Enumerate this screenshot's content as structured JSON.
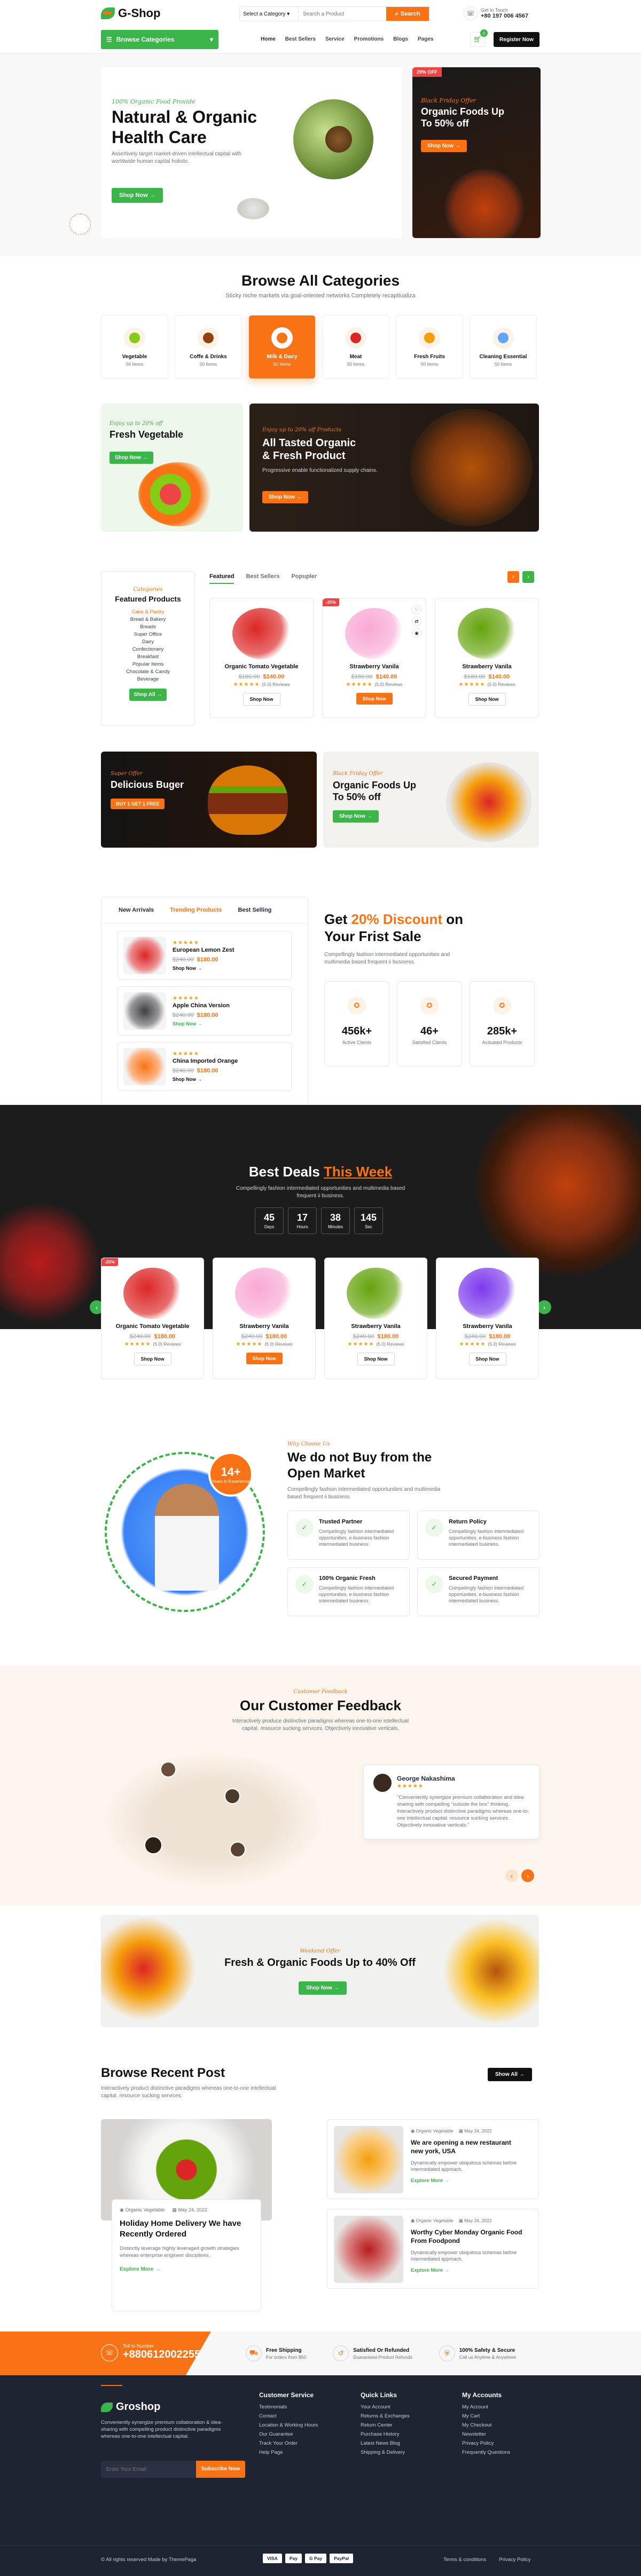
{
  "topbar": {
    "logo": "G-Shop",
    "categories_btn": "Browse Categories",
    "nav": [
      "Home",
      "Best Sellers",
      "Service",
      "Promotions",
      "Blogs",
      "Pages"
    ],
    "search_category": "Select a Category",
    "search_placeholder": "Search a Product",
    "search_btn": "Search",
    "contact_label": "Get In Touch",
    "contact_phone": "+80 197 006 4567",
    "cart_count": "0",
    "register": "Register Now"
  },
  "hero": {
    "tag": "100% Organic Food Provide",
    "title1": "Natural & Organic",
    "title2": "Health Care",
    "desc": "Assertively target market-driven intellectual capital with worldwide human capital holistic.",
    "btn": "Shop Now",
    "side_badge": "20% OFF",
    "side_tag": "Black Friday Offer",
    "side_title1": "Organic Foods Up",
    "side_title2": "To 50% off",
    "side_btn": "Shop Now"
  },
  "categories": {
    "title": "Browse All Categories",
    "sub": "Sticky niche markets via goal-oriented networks Completely recaptiualiza",
    "items": [
      {
        "name": "Vegetable",
        "count": "50 Items",
        "icon": "vegetable-icon"
      },
      {
        "name": "Coffe & Drinks",
        "count": "50 Items",
        "icon": "coffee-icon"
      },
      {
        "name": "Milk & Dairy",
        "count": "50 Items",
        "icon": "milk-icon"
      },
      {
        "name": "Meat",
        "count": "50 Items",
        "icon": "meat-icon"
      },
      {
        "name": "Fresh Fruits",
        "count": "50 Items",
        "icon": "fruit-icon"
      },
      {
        "name": "Cleaning Essential",
        "count": "50 Items",
        "icon": "cleaning-icon"
      }
    ]
  },
  "promo1": {
    "tag": "Enjoy up to 20% off",
    "title": "Fresh Vegetable",
    "btn": "Shop Now"
  },
  "promo2": {
    "tag": "Enjoy up to 20% off Products",
    "title1": "All Tasted Organic",
    "title2": "& Fresh Product",
    "desc": "Progressive enable functionalized supply chains.",
    "btn": "Shop Now"
  },
  "featured": {
    "sidebar_tag": "Categories",
    "sidebar_title": "Featured Products",
    "list": [
      "Cake & Pastry",
      "Bread & Bakery",
      "Breads",
      "Super Office",
      "Dairy",
      "Confectionery",
      "Breakfast",
      "Popular Items",
      "Chocolate & Candy",
      "Beverage"
    ],
    "sidebar_btn": "Shop All",
    "tabs": [
      "Featured",
      "Best Sellers",
      "Popupler"
    ],
    "products": [
      {
        "name": "Organic Tomato Vegetable",
        "old": "$180.00",
        "new": "$240.00",
        "reviews": "(5.0) Reviews",
        "btn": "Shop Now",
        "badge": ""
      },
      {
        "name": "Strawberry Vanila",
        "old": "$180.00",
        "new": "$140.00",
        "reviews": "(5.0) Reviews",
        "btn": "Shop Now",
        "badge": "-25%"
      },
      {
        "name": "Strawberry Vanila",
        "old": "$180.00",
        "new": "$140.00",
        "reviews": "(5.0) Reviews",
        "btn": "Shop Now",
        "badge": ""
      }
    ]
  },
  "banner_burger": {
    "tag": "Super Offer",
    "title": "Delicious Buger",
    "badge": "BUY 1 GET 1 FREE"
  },
  "banner_foods": {
    "tag": "Black Friday Offer",
    "title1": "Organic Foods Up",
    "title2": "To 50% off",
    "btn": "Shop Now"
  },
  "tabs_section": {
    "tabs": [
      "New Arrivals",
      "Trending Products",
      "Best Selling"
    ],
    "items": [
      {
        "name": "European Lemon Zest",
        "old": "$240.00",
        "new": "$180.00",
        "btn": "Shop Now"
      },
      {
        "name": "Apple China Version",
        "old": "$240.00",
        "new": "$180.00",
        "btn": "Shop Now"
      },
      {
        "name": "China Imported Orange",
        "old": "$240.00",
        "new": "$180.00",
        "btn": "Shop Now"
      }
    ]
  },
  "discount": {
    "title_pre": "Get ",
    "title_hl": "20% Discount",
    "title_post": " on",
    "title2": "Your Frist Sale",
    "desc": "Compellingly fashion intermediated opportunities and multimedia based frequent ii business.",
    "stats": [
      {
        "value": "456k+",
        "label": "Active Clients"
      },
      {
        "value": "46+",
        "label": "Satisfied Clients"
      },
      {
        "value": "285k+",
        "label": "Activated Products"
      }
    ]
  },
  "deals": {
    "title_pre": "Best Deals ",
    "title_hl": "This Week",
    "sub": "Compellingly fashion intermediated opportunities and multimedia based frequent ii business.",
    "timer": [
      {
        "v": "45",
        "l": "Days"
      },
      {
        "v": "17",
        "l": "Hours"
      },
      {
        "v": "38",
        "l": "Minutes"
      },
      {
        "v": "145",
        "l": "Sec"
      }
    ],
    "products": [
      {
        "name": "Organic Tomato Vegetable",
        "old": "$240.00",
        "new": "$180.00",
        "reviews": "(5.0) Reviews",
        "btn": "Shop Now",
        "badge": "-25%"
      },
      {
        "name": "Strawberry Vanila",
        "old": "$240.00",
        "new": "$180.00",
        "reviews": "(5.0) Reviews",
        "btn": "Shop Now",
        "badge": ""
      },
      {
        "name": "Strawberry Vanila",
        "old": "$240.00",
        "new": "$180.00",
        "reviews": "(5.0) Reviews",
        "btn": "Shop Now",
        "badge": ""
      },
      {
        "name": "Strawberry Vanila",
        "old": "$240.00",
        "new": "$180.00",
        "reviews": "(5.0) Reviews",
        "btn": "Shop Now",
        "badge": ""
      }
    ]
  },
  "why": {
    "tag": "Why Choose Us",
    "title1": "We do not Buy from the",
    "title2": "Open Market",
    "desc": "Compellingly fashion intermediated opportunities and multimedia based frequent ii business.",
    "badge_num": "14+",
    "badge_text": "Years in Experience",
    "features": [
      {
        "title": "Trusted Partner",
        "desc": "Compellingly fashion intermediated opportunities. e-business fashion intermediated business."
      },
      {
        "title": "Return Policy",
        "desc": "Compellingly fashion intermediated opportunities. e-business fashion intermediated business."
      },
      {
        "title": "100% Organic Fresh",
        "desc": "Compellingly fashion intermediated opportunities. e-business fashion intermediated business."
      },
      {
        "title": "Secured Payment",
        "desc": "Compellingly fashion intermediated opportunities. e-business fashion intermediated business."
      }
    ]
  },
  "feedback": {
    "tag": "Customer Feedback",
    "title": "Our Customer Feedback",
    "sub": "Interactively produce distinctive paradigms whereas one-to-one intellectual capital. resource sucking services. Objectively innovative verticals.",
    "name": "George Nakashima",
    "quote": "\"Conveniently synergize premium collaboration and idea-sharing with compelling \"outside the box\" thinking. Interactively product distinctive paradigms whereas one-to-one intellectual capital. resource sucking services. Objectively innovative verticals.\""
  },
  "banner_wide": {
    "tag": "Weekend Offer",
    "title": "Fresh & Organic Foods Up to 40% Off",
    "btn": "Shop Now"
  },
  "blog": {
    "title": "Browse Recent Post",
    "sub": "Interactively product distinctive paradigms whereas one-to-one intellectual capital. resource sucking services.",
    "btn": "Show All",
    "main": {
      "cat": "Organic Vegetable",
      "date": "May 24, 2022",
      "title1": "Holiday Home Delivery We have",
      "title2": "Recently Ordered",
      "desc": "Distinctly leverage highly leveraged growth strategies whereas enterprise engineer disciplines.",
      "link": "Explore More"
    },
    "side": [
      {
        "cat": "Organic Vegetable",
        "date": "May 24, 2022",
        "title1": "We are opening a new restaurant",
        "title2": "new york, USA",
        "desc": "Dynamically empower ubiquitous schemas before intermediated approach.",
        "link": "Explore More"
      },
      {
        "cat": "Organic Vegetable",
        "date": "May 24, 2022",
        "title1": "Worthy Cyber Monday Organic Food",
        "title2": "From Foodpond",
        "desc": "Dynamically empower ubiquitous schemas before intermediated approach.",
        "link": "Explore More"
      }
    ]
  },
  "features_bar": {
    "call_label": "Toll to Number",
    "call_number": "+880612002255",
    "items": [
      {
        "title": "Free Shipping",
        "sub": "For orders from $50"
      },
      {
        "title": "Satisfied Or Refunded",
        "sub": "Guaranteed Product Refunds"
      },
      {
        "title": "100% Safety & Secure",
        "sub": "Call us Anytime & Anywhere"
      }
    ]
  },
  "footer": {
    "logo": "Groshop",
    "desc": "Conveniently synergize premium collaboration & idea-sharing with compelling product distinctive paradigms whereas one-to-one intellectual capital.",
    "email_placeholder": "Enter Your Email",
    "subscribe": "Subscribe Now",
    "cols": [
      {
        "title": "Customer Service",
        "links": [
          "Testimonials",
          "Contact",
          "Location & Working Hours",
          "Our Guarantee",
          "Track Your Order",
          "Help Page"
        ]
      },
      {
        "title": "Quick Links",
        "links": [
          "Your Account",
          "Returns & Exchanges",
          "Return Center",
          "Purchase History",
          "Latest News Blog",
          "Shipping & Delivery"
        ]
      },
      {
        "title": "My Accounts",
        "links": [
          "My Account",
          "My Cart",
          "My Checkout",
          "Newsletter",
          "Privacy Policy",
          "Frequently Questions"
        ]
      }
    ],
    "copyright": "All rights reserved Made by ThemePaga",
    "payments": [
      "VISA",
      "Pay",
      "G Pay",
      "PayPal"
    ],
    "legal": [
      "Terms & conditions",
      "Privacy Policy"
    ]
  },
  "colors": {
    "green": "#3bb54a",
    "orange": "#f97316",
    "dark": "#1f2937"
  }
}
